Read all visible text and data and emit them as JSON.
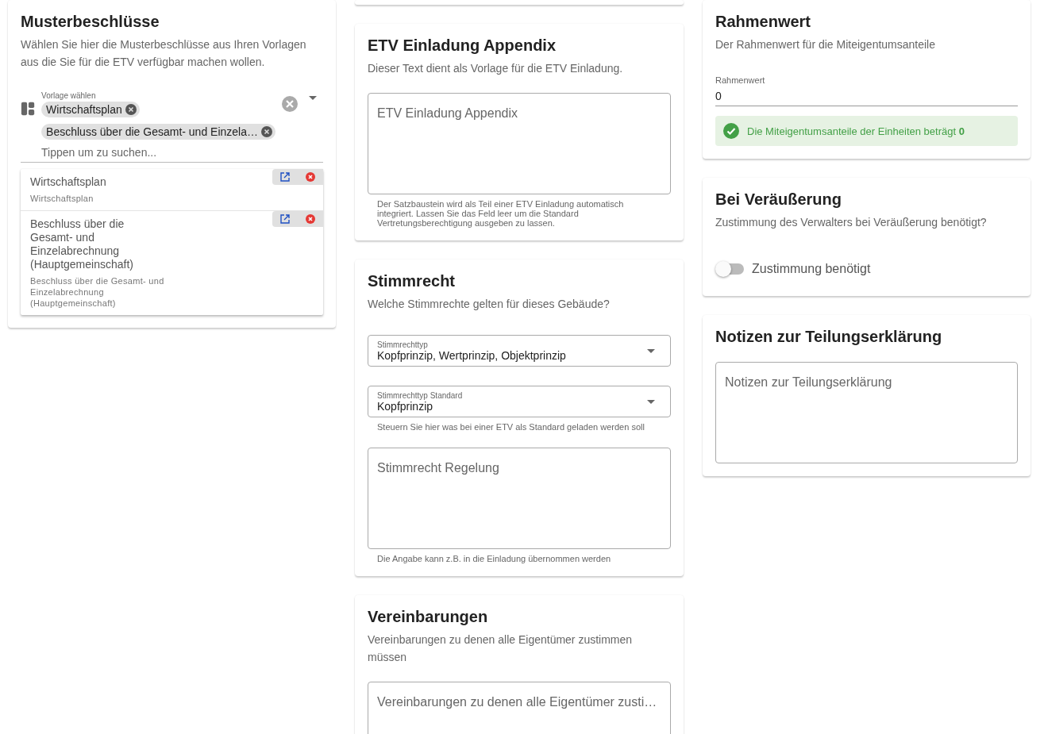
{
  "musterbeschluesse": {
    "title": "Musterbeschlüsse",
    "description": "Wählen Sie hier die Musterbeschlüsse aus Ihren Vorlagen aus die Sie für die ETV verfügbar machen wollen.",
    "select": {
      "label": "Vorlage wählen",
      "chips": [
        "Wirtschaftsplan",
        "Beschluss über die Gesamt- und Einzela…"
      ],
      "placeholder": "Tippen um zu suchen..."
    },
    "options": [
      {
        "title": "Wirtschaftsplan",
        "subtitle": "Wirtschaftsplan"
      },
      {
        "title": "Beschluss über die Gesamt- und Einzelabrechnung (Hauptgemeinschaft)",
        "subtitle": "Beschluss über die Gesamt- und Einzelabrechnung (Hauptgemeinschaft)"
      }
    ]
  },
  "etv_einladung_appendix": {
    "title": "ETV Einladung Appendix",
    "description": "Dieser Text dient als Vorlage für die ETV Einladung.",
    "textarea": {
      "placeholder": "ETV Einladung Appendix"
    },
    "hint": "Der Satzbaustein wird als Teil einer ETV Einladung automatisch integriert. Lassen Sie das Feld leer um die Standard Vertretungsberechtigung ausgeben zu lassen."
  },
  "stimmrecht": {
    "title": "Stimmrecht",
    "description": "Welche Stimmrechte gelten für dieses Gebäude?",
    "selects": [
      {
        "label": "Stimmrechttyp",
        "value": "Kopfprinzip, Wertprinzip, Objektprinzip"
      },
      {
        "label": "Stimmrechttyp Standard",
        "value": "Kopfprinzip",
        "hint": "Steuern Sie hier was bei einer ETV als Standard geladen werden soll"
      }
    ],
    "textarea": {
      "placeholder": "Stimmrecht Regelung"
    },
    "hint": "Die Angabe kann z.B. in die Einladung übernommen werden"
  },
  "vereinbarungen": {
    "title": "Vereinbarungen",
    "description": "Vereinbarungen zu denen alle Eigentümer zustimmen müssen",
    "textarea": {
      "placeholder": "Vereinbarungen zu denen alle Eigentümer zusti…"
    }
  },
  "rahmenwert": {
    "title": "Rahmenwert",
    "description": "Der Rahmenwert für die Miteigentumsanteile",
    "field": {
      "label": "Rahmenwert",
      "value": "0"
    },
    "alert": "Die Miteigentumsanteile der Einheiten beträgt **0**"
  },
  "veraeusserung": {
    "title": "Bei Veräußerung",
    "description": "Zustimmung des Verwalters bei Veräußerung benötigt?",
    "toggle": {
      "label": "Zustimmung benötigt",
      "on": false
    }
  },
  "notizen": {
    "title": "Notizen zur Teilungserklärung",
    "textarea": {
      "placeholder": "Notizen zur Teilungserklärung"
    }
  }
}
